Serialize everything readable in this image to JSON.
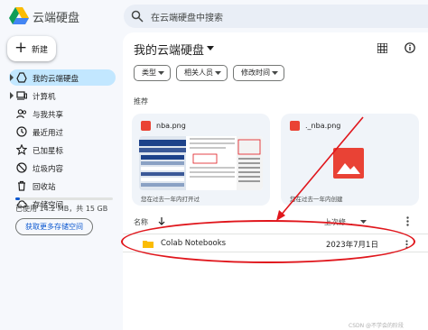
{
  "app": {
    "title": "云端硬盘",
    "search_placeholder": "在云端硬盘中搜索"
  },
  "sidebar": {
    "new_label": "新建",
    "items": [
      {
        "label": "我的云端硬盘",
        "icon": "drive-icon",
        "active": true
      },
      {
        "label": "计算机",
        "icon": "computer-icon"
      },
      {
        "label": "与我共享",
        "icon": "shared-icon"
      },
      {
        "label": "最近用过",
        "icon": "clock-icon"
      },
      {
        "label": "已加星标",
        "icon": "star-icon"
      },
      {
        "label": "垃圾内容",
        "icon": "trash-icon"
      },
      {
        "label": "回收站",
        "icon": "bin-icon"
      },
      {
        "label": "存储空间",
        "icon": "cloud-icon"
      }
    ],
    "storage_text": "已使用 14.2 MB，共 15 GB",
    "storage_fraction": 0.05,
    "buy_label": "获取更多存储空间"
  },
  "main": {
    "title": "我的云端硬盘",
    "filters": [
      "类型",
      "相关人员",
      "修改时间"
    ],
    "suggested_label": "推荐",
    "cards": [
      {
        "name": "nba.png",
        "meta": "您在过去一年内打开过"
      },
      {
        "name": "._nba.png",
        "meta": "您在过去一年内创建"
      }
    ],
    "list": {
      "name_header": "名称",
      "modified_header": "上次修...",
      "rows": [
        {
          "name": "Colab Notebooks",
          "modified": "2023年7月1日"
        }
      ]
    }
  },
  "watermark": "CSDN @不学会的阶段",
  "colors": {
    "accent": "#0b57d0",
    "active_nav": "#c2e7ff",
    "annotation": "#e0161c",
    "folder": "#fbbc04",
    "image_file": "#ea4335"
  }
}
